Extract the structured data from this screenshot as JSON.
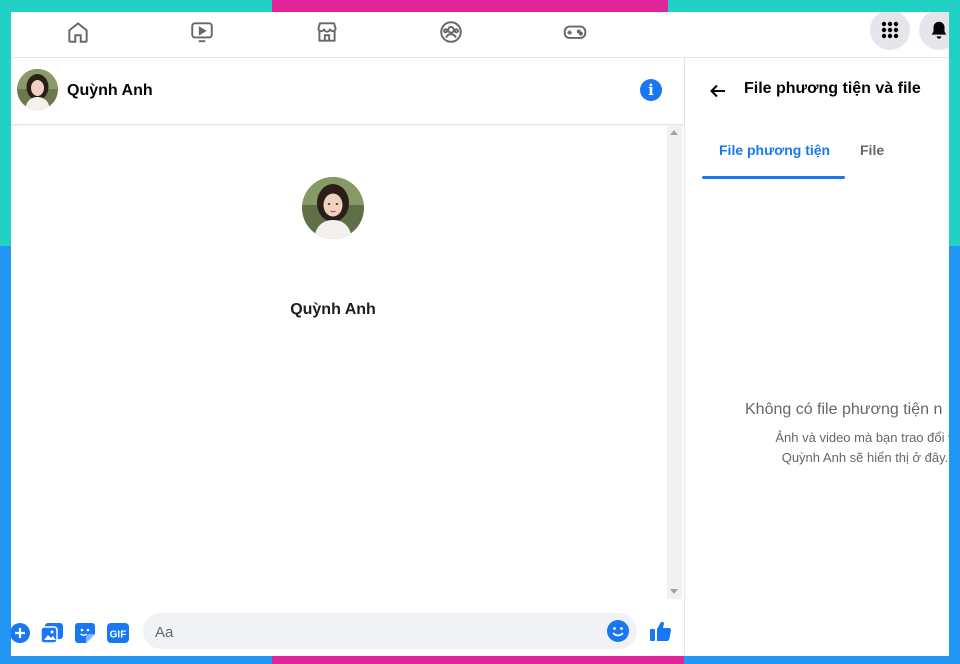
{
  "chat": {
    "contact_name": "Quỳnh Anh",
    "profile_name": "Quỳnh Anh",
    "message_placeholder": "Aa"
  },
  "composer": {
    "gif_label": "GIF"
  },
  "side_panel": {
    "title": "File phương tiện và file",
    "tabs": [
      {
        "label": "File phương tiện",
        "active": true
      },
      {
        "label": "File",
        "active": false
      }
    ],
    "empty_title": "Không có file phương tiện n",
    "empty_desc_line1": "Ảnh và video mà bạn trao đổi v",
    "empty_desc_line2": "Quỳnh Anh sẽ hiển thị ở đây."
  },
  "colors": {
    "accent": "#1877f2",
    "frame_teal": "#22d1c6",
    "frame_pink": "#e0249a",
    "frame_blue": "#2196f3"
  },
  "icons": {
    "nav": [
      "home-icon",
      "watch-video-icon",
      "marketplace-icon",
      "groups-icon",
      "gaming-icon"
    ],
    "top_right": [
      "menu-grid-icon",
      "notification-bell-icon"
    ],
    "composer": [
      "plus-circle-icon",
      "photo-icon",
      "sticker-icon",
      "gif-icon",
      "emoji-icon",
      "like-thumb-icon"
    ]
  }
}
